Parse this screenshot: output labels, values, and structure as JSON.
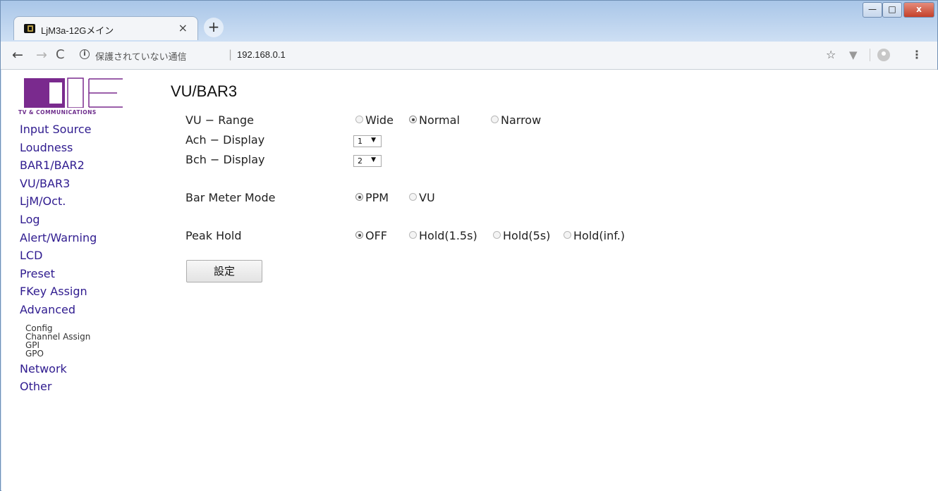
{
  "browser": {
    "tab_title": "LjM3a-12Gメイン",
    "tab_close": "×",
    "new_tab": "+",
    "url_warning": "保護されていない通信",
    "url_separator": "|",
    "url_host": "192.168.0.1",
    "window_controls": {
      "minimize": "—",
      "maximize": "□",
      "close": "x"
    }
  },
  "logo": {
    "tagline": "TV & COMMUNICATIONS"
  },
  "sidebar": {
    "items": [
      {
        "label": "Input Source"
      },
      {
        "label": "Loudness"
      },
      {
        "label": "BAR1/BAR2"
      },
      {
        "label": "VU/BAR3"
      },
      {
        "label": "LjM/Oct."
      },
      {
        "label": "Log"
      },
      {
        "label": "Alert/Warning"
      },
      {
        "label": "LCD"
      },
      {
        "label": "Preset"
      },
      {
        "label": "FKey Assign"
      },
      {
        "label": "Advanced"
      }
    ],
    "sub_items": [
      {
        "label": "Config"
      },
      {
        "label": "Channel Assign"
      },
      {
        "label": "GPI"
      },
      {
        "label": "GPO"
      }
    ],
    "bottom_items": [
      {
        "label": "Network"
      },
      {
        "label": "Other"
      }
    ]
  },
  "main": {
    "title": "VU/BAR3",
    "vu_range": {
      "label": "VU − Range",
      "options": [
        "Wide",
        "Normal",
        "Narrow"
      ],
      "selected": "Normal"
    },
    "ach_display": {
      "label": "Ach − Display",
      "value": "1"
    },
    "bch_display": {
      "label": "Bch − Display",
      "value": "2"
    },
    "bar_meter_mode": {
      "label": "Bar Meter Mode",
      "options": [
        "PPM",
        "VU"
      ],
      "selected": "PPM"
    },
    "peak_hold": {
      "label": "Peak Hold",
      "options": [
        "OFF",
        "Hold(1.5s)",
        "Hold(5s)",
        "Hold(inf.)"
      ],
      "selected": "OFF"
    },
    "submit_label": "設定"
  },
  "colors": {
    "nav_link": "#2f1b8f",
    "logo_purple": "#6d2d8c"
  }
}
